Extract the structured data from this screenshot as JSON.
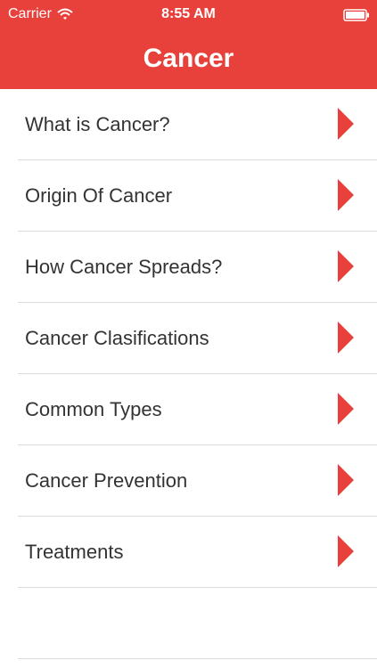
{
  "status_bar": {
    "carrier": "Carrier",
    "time": "8:55 AM",
    "wifi_icon": "wifi-icon",
    "battery_icon": "battery-icon"
  },
  "nav": {
    "title": "Cancer"
  },
  "menu": {
    "items": [
      {
        "label": "What is Cancer?",
        "icon": "chevron-right-icon"
      },
      {
        "label": "Origin Of Cancer",
        "icon": "chevron-right-icon"
      },
      {
        "label": "How Cancer Spreads?",
        "icon": "chevron-right-icon"
      },
      {
        "label": "Cancer Clasifications",
        "icon": "chevron-right-icon"
      },
      {
        "label": "Common Types",
        "icon": "chevron-right-icon"
      },
      {
        "label": "Cancer Prevention",
        "icon": "chevron-right-icon"
      },
      {
        "label": "Treatments",
        "icon": "chevron-right-icon"
      }
    ]
  },
  "colors": {
    "header": "#e8413b",
    "chevron": "#e8413b",
    "text": "#333333",
    "separator": "#dcdcdc"
  }
}
